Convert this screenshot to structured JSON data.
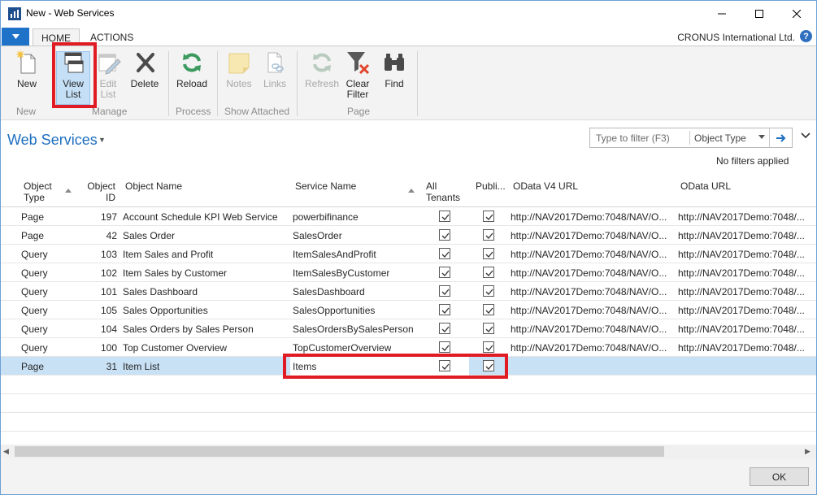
{
  "window": {
    "title": "New - Web Services"
  },
  "tabs": {
    "home": "HOME",
    "actions": "ACTIONS"
  },
  "company": "CRONUS International Ltd.",
  "help": "?",
  "ribbon": {
    "new": "New",
    "view_list": [
      "View",
      "List"
    ],
    "edit_list": [
      "Edit",
      "List"
    ],
    "delete": "Delete",
    "reload": "Reload",
    "notes": "Notes",
    "links": "Links",
    "refresh": "Refresh",
    "clear_filter": [
      "Clear",
      "Filter"
    ],
    "find": "Find",
    "groups": {
      "new": "New",
      "manage": "Manage",
      "process": "Process",
      "show_attached": "Show Attached",
      "page": "Page"
    }
  },
  "page": {
    "title": "Web Services",
    "filter_placeholder": "Type to filter (F3)",
    "filter_field": "Object Type",
    "no_filters": "No filters applied"
  },
  "columns": {
    "object_type": [
      "Object",
      "Type"
    ],
    "object_id": [
      "Object",
      "ID"
    ],
    "object_name": "Object Name",
    "service_name": "Service Name",
    "all_tenants": [
      "All",
      "Tenants"
    ],
    "published": "Publi...",
    "odata_v4_url": "OData V4 URL",
    "odata_url": "OData URL"
  },
  "rows": [
    {
      "type": "Page",
      "id": "197",
      "name": "Account Schedule KPI Web Service",
      "service": "powerbifinance",
      "all_tenants": true,
      "published": true,
      "odata_v4": "http://NAV2017Demo:7048/NAV/O...",
      "odata": "http://NAV2017Demo:7048/..."
    },
    {
      "type": "Page",
      "id": "42",
      "name": "Sales Order",
      "service": "SalesOrder",
      "all_tenants": true,
      "published": true,
      "odata_v4": "http://NAV2017Demo:7048/NAV/O...",
      "odata": "http://NAV2017Demo:7048/..."
    },
    {
      "type": "Query",
      "id": "103",
      "name": "Item Sales and Profit",
      "service": "ItemSalesAndProfit",
      "all_tenants": true,
      "published": true,
      "odata_v4": "http://NAV2017Demo:7048/NAV/O...",
      "odata": "http://NAV2017Demo:7048/..."
    },
    {
      "type": "Query",
      "id": "102",
      "name": "Item Sales by Customer",
      "service": "ItemSalesByCustomer",
      "all_tenants": true,
      "published": true,
      "odata_v4": "http://NAV2017Demo:7048/NAV/O...",
      "odata": "http://NAV2017Demo:7048/..."
    },
    {
      "type": "Query",
      "id": "101",
      "name": "Sales Dashboard",
      "service": "SalesDashboard",
      "all_tenants": true,
      "published": true,
      "odata_v4": "http://NAV2017Demo:7048/NAV/O...",
      "odata": "http://NAV2017Demo:7048/..."
    },
    {
      "type": "Query",
      "id": "105",
      "name": "Sales Opportunities",
      "service": "SalesOpportunities",
      "all_tenants": true,
      "published": true,
      "odata_v4": "http://NAV2017Demo:7048/NAV/O...",
      "odata": "http://NAV2017Demo:7048/..."
    },
    {
      "type": "Query",
      "id": "104",
      "name": "Sales Orders by Sales Person",
      "service": "SalesOrdersBySalesPerson",
      "all_tenants": true,
      "published": true,
      "odata_v4": "http://NAV2017Demo:7048/NAV/O...",
      "odata": "http://NAV2017Demo:7048/..."
    },
    {
      "type": "Query",
      "id": "100",
      "name": "Top Customer Overview",
      "service": "TopCustomerOverview",
      "all_tenants": true,
      "published": true,
      "odata_v4": "http://NAV2017Demo:7048/NAV/O...",
      "odata": "http://NAV2017Demo:7048/..."
    },
    {
      "type": "Page",
      "id": "31",
      "name": "Item List",
      "service": "Items",
      "all_tenants": true,
      "published": true,
      "odata_v4": "",
      "odata": ""
    }
  ],
  "footer": {
    "ok": "OK"
  },
  "colors": {
    "accent": "#1e73c8",
    "selected_row": "#c9e1f5",
    "highlight_box": "#e01b24"
  }
}
